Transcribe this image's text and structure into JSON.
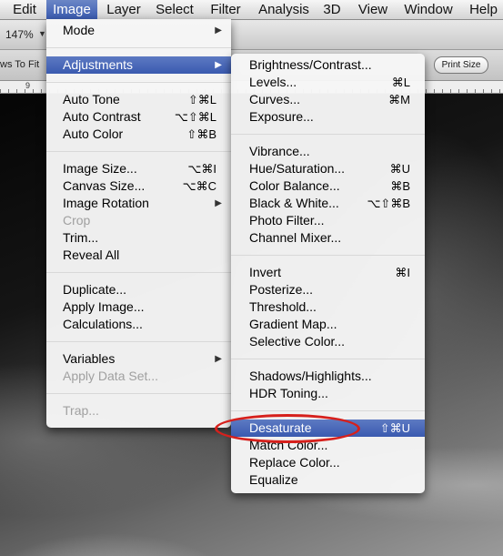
{
  "menubar": [
    "Edit",
    "Image",
    "Layer",
    "Select",
    "Filter",
    "Analysis",
    "3D",
    "View",
    "Window",
    "Help"
  ],
  "active_menu": "Image",
  "options": {
    "zoom": "147%",
    "fit_label": "ws To Fit",
    "print_size": "Print Size"
  },
  "ruler": {
    "label": "9"
  },
  "image_menu": {
    "mode": "Mode",
    "adjustments": "Adjustments",
    "auto_tone": {
      "label": "Auto Tone",
      "shortcut": "⇧⌘L"
    },
    "auto_contrast": {
      "label": "Auto Contrast",
      "shortcut": "⌥⇧⌘L"
    },
    "auto_color": {
      "label": "Auto Color",
      "shortcut": "⇧⌘B"
    },
    "image_size": {
      "label": "Image Size...",
      "shortcut": "⌥⌘I"
    },
    "canvas_size": {
      "label": "Canvas Size...",
      "shortcut": "⌥⌘C"
    },
    "image_rotation": "Image Rotation",
    "crop": "Crop",
    "trim": "Trim...",
    "reveal_all": "Reveal All",
    "duplicate": "Duplicate...",
    "apply_image": "Apply Image...",
    "calculations": "Calculations...",
    "variables": "Variables",
    "apply_data_set": "Apply Data Set...",
    "trap": "Trap..."
  },
  "adjustments_menu": {
    "brightness_contrast": {
      "label": "Brightness/Contrast...",
      "shortcut": ""
    },
    "levels": {
      "label": "Levels...",
      "shortcut": "⌘L"
    },
    "curves": {
      "label": "Curves...",
      "shortcut": "⌘M"
    },
    "exposure": {
      "label": "Exposure...",
      "shortcut": ""
    },
    "vibrance": {
      "label": "Vibrance...",
      "shortcut": ""
    },
    "hue_saturation": {
      "label": "Hue/Saturation...",
      "shortcut": "⌘U"
    },
    "color_balance": {
      "label": "Color Balance...",
      "shortcut": "⌘B"
    },
    "black_white": {
      "label": "Black & White...",
      "shortcut": "⌥⇧⌘B"
    },
    "photo_filter": {
      "label": "Photo Filter...",
      "shortcut": ""
    },
    "channel_mixer": {
      "label": "Channel Mixer...",
      "shortcut": ""
    },
    "invert": {
      "label": "Invert",
      "shortcut": "⌘I"
    },
    "posterize": {
      "label": "Posterize...",
      "shortcut": ""
    },
    "threshold": {
      "label": "Threshold...",
      "shortcut": ""
    },
    "gradient_map": {
      "label": "Gradient Map...",
      "shortcut": ""
    },
    "selective_color": {
      "label": "Selective Color...",
      "shortcut": ""
    },
    "shadows_highlights": {
      "label": "Shadows/Highlights...",
      "shortcut": ""
    },
    "hdr_toning": {
      "label": "HDR Toning...",
      "shortcut": ""
    },
    "desaturate": {
      "label": "Desaturate",
      "shortcut": "⇧⌘U"
    },
    "match_color": {
      "label": "Match Color...",
      "shortcut": ""
    },
    "replace_color": {
      "label": "Replace Color...",
      "shortcut": ""
    },
    "equalize": {
      "label": "Equalize",
      "shortcut": ""
    }
  },
  "highlight_color": "#d6201c",
  "selection_color": "#3a5ab0"
}
